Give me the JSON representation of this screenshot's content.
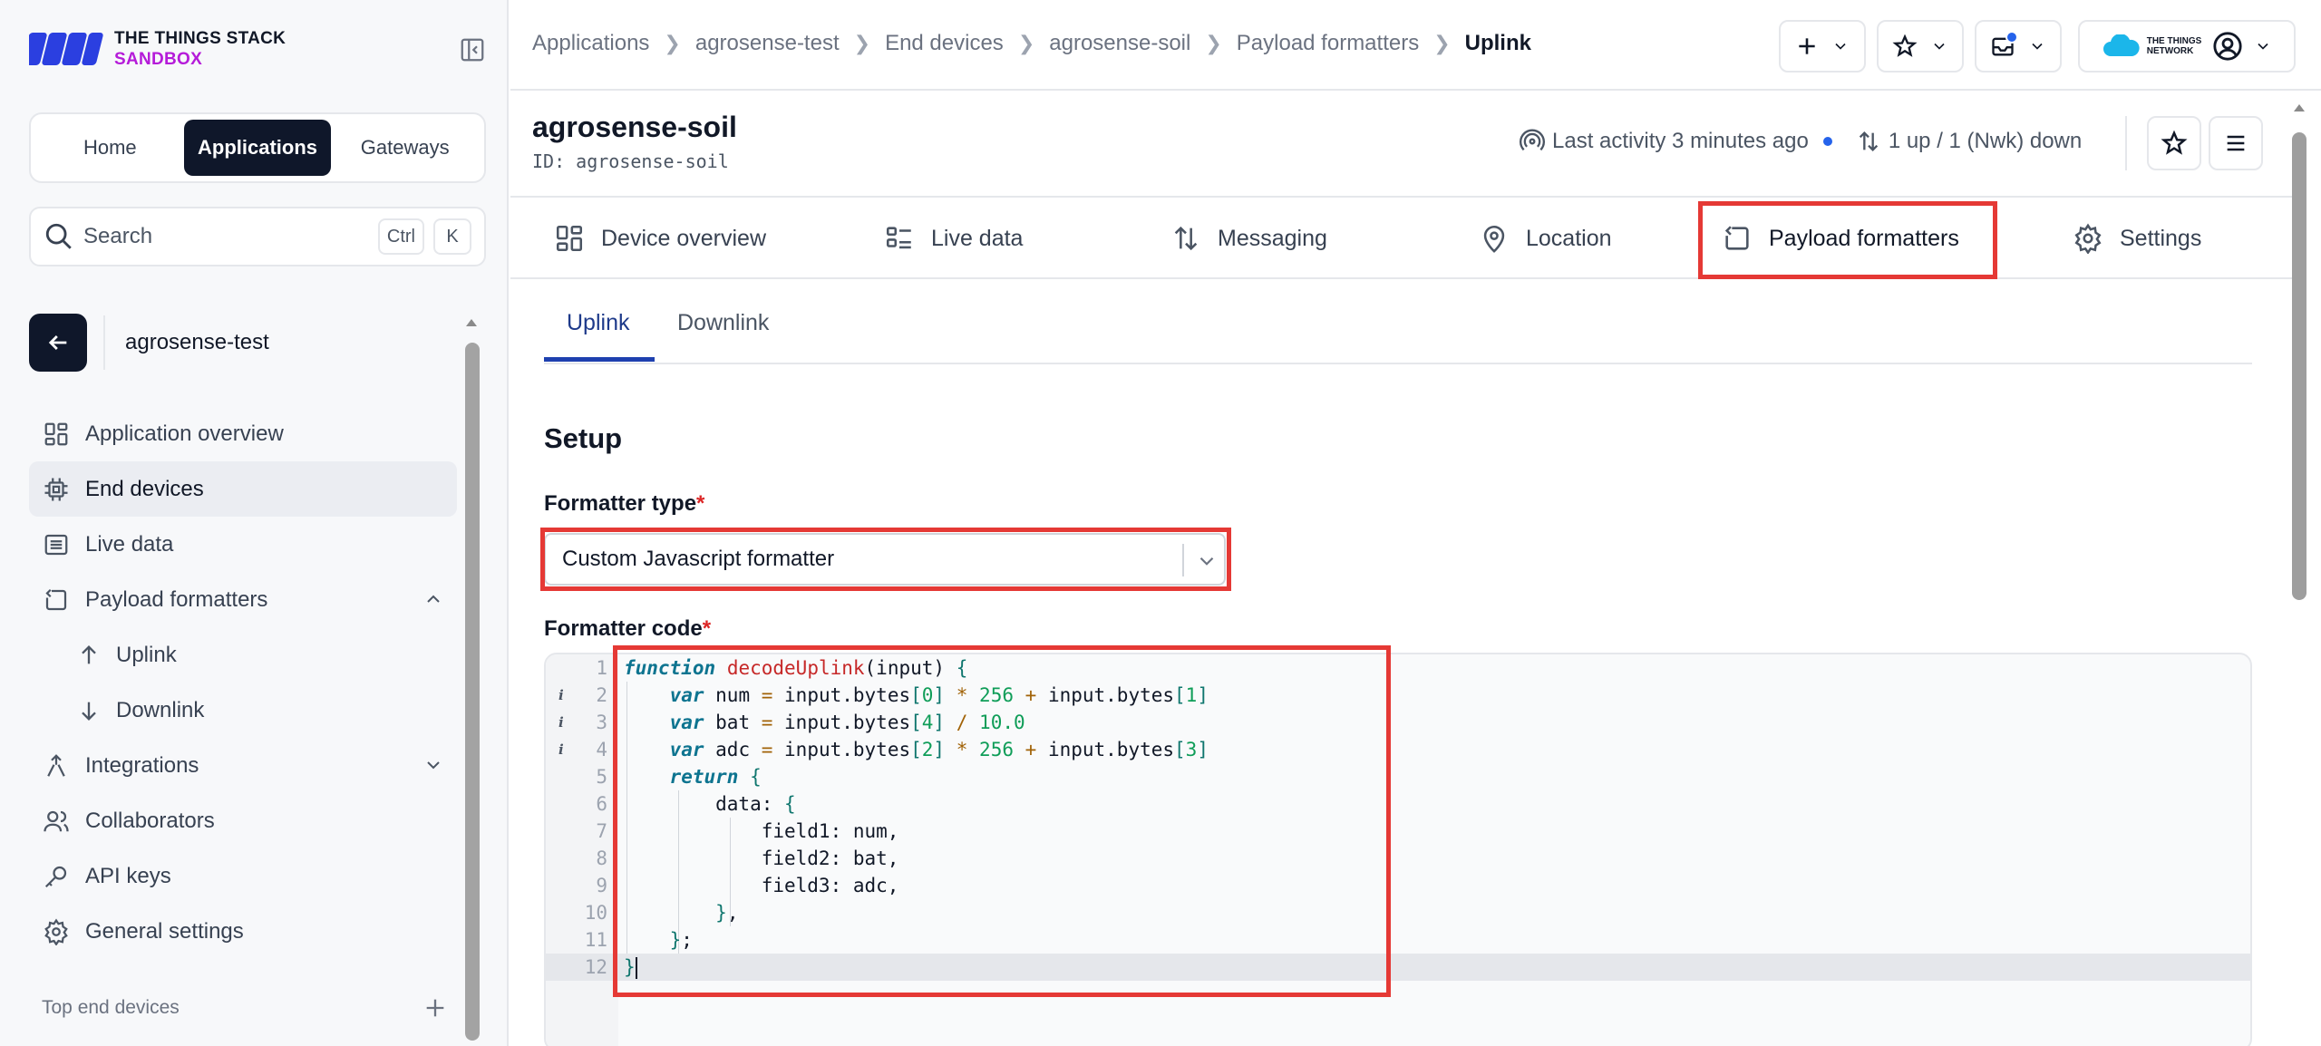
{
  "brand": {
    "line1": "THE THINGS STACK",
    "line2": "SANDBOX"
  },
  "switcher": {
    "home": "Home",
    "applications": "Applications",
    "gateways": "Gateways"
  },
  "search": {
    "label": "Search",
    "key1": "Ctrl",
    "key2": "K"
  },
  "application": {
    "name": "agrosense-test"
  },
  "sidebar": {
    "items": [
      {
        "label": "Application overview"
      },
      {
        "label": "End devices"
      },
      {
        "label": "Live data"
      },
      {
        "label": "Payload formatters"
      },
      {
        "label": "Uplink"
      },
      {
        "label": "Downlink"
      },
      {
        "label": "Integrations"
      },
      {
        "label": "Collaborators"
      },
      {
        "label": "API keys"
      },
      {
        "label": "General settings"
      }
    ],
    "top_devices_label": "Top end devices"
  },
  "breadcrumb": [
    "Applications",
    "agrosense-test",
    "End devices",
    "agrosense-soil",
    "Payload formatters",
    "Uplink"
  ],
  "header": {
    "network_logo_text_1": "THE THINGS",
    "network_logo_text_2": "NETWORK"
  },
  "device": {
    "title": "agrosense-soil",
    "id_label": "ID:",
    "id_value": "agrosense-soil",
    "last_activity": "Last activity 3 minutes ago",
    "traffic": "1 up / 1 (Nwk) down"
  },
  "tabs": [
    "Device overview",
    "Live data",
    "Messaging",
    "Location",
    "Payload formatters",
    "Settings"
  ],
  "subtabs": [
    "Uplink",
    "Downlink"
  ],
  "setup": {
    "title": "Setup",
    "formatter_type_label": "Formatter type",
    "formatter_type_value": "Custom Javascript formatter",
    "formatter_code_label": "Formatter code",
    "required_mark": "*"
  },
  "code_lines": [
    "function decodeUplink(input) {",
    "    var num = input.bytes[0] * 256 + input.bytes[1]",
    "    var bat = input.bytes[4] / 10.0",
    "    var adc = input.bytes[2] * 256 + input.bytes[3]",
    "    return {",
    "        data: {",
    "            field1: num,",
    "            field2: bat,",
    "            field3: adc,",
    "        },",
    "    };",
    "}"
  ],
  "line_numbers": [
    "1",
    "2",
    "3",
    "4",
    "5",
    "6",
    "7",
    "8",
    "9",
    "10",
    "11",
    "12"
  ],
  "info_marker": "i",
  "colors": {
    "brand_purple": "#b51bd9",
    "dark": "#0f172a",
    "accent_blue": "#1e40af",
    "highlight_red": "#e53935"
  }
}
